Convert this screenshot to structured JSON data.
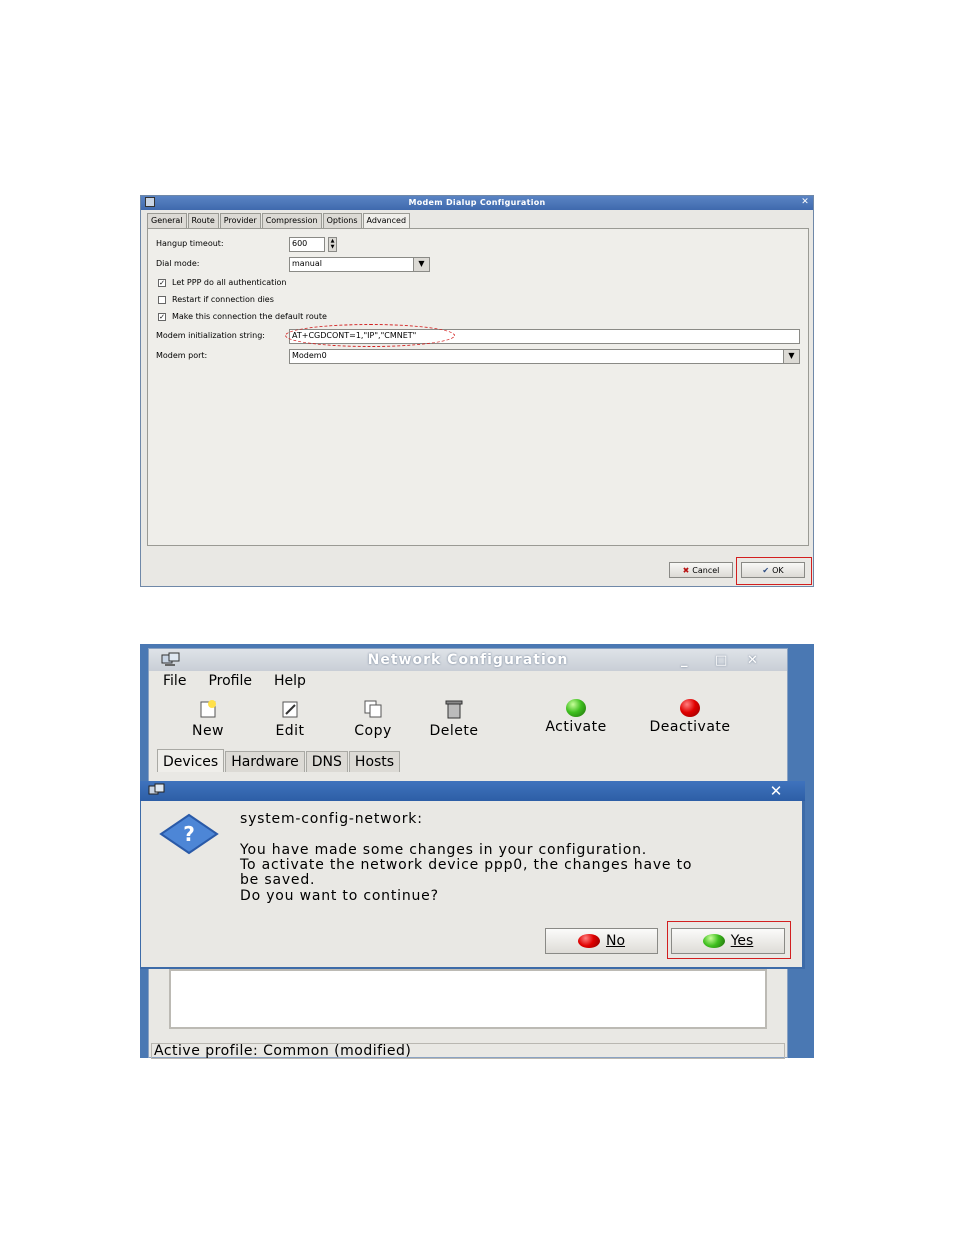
{
  "modem_dialog": {
    "title": "Modem Dialup Configuration",
    "tabs": [
      "General",
      "Route",
      "Provider",
      "Compression",
      "Options",
      "Advanced"
    ],
    "active_tab": "Advanced",
    "hangup_timeout_label": "Hangup timeout:",
    "hangup_timeout_value": "600",
    "dial_mode_label": "Dial mode:",
    "dial_mode_value": "manual",
    "check_ppp_auth": {
      "label": "Let PPP do all authentication",
      "checked": true
    },
    "check_restart": {
      "label": "Restart if connection dies",
      "checked": false
    },
    "check_default_route": {
      "label": "Make this connection the default route",
      "checked": true
    },
    "init_string_label": "Modem initialization string:",
    "init_string_value": "AT+CGDCONT=1,\"IP\",\"CMNET\"",
    "modem_port_label": "Modem port:",
    "modem_port_value": "Modem0",
    "cancel_label": "Cancel",
    "ok_label": "OK"
  },
  "network_window": {
    "title": "Network Configuration",
    "menu": [
      "File",
      "Profile",
      "Help"
    ],
    "toolbar": [
      "New",
      "Edit",
      "Copy",
      "Delete",
      "Activate",
      "Deactivate"
    ],
    "tabs": [
      "Devices",
      "Hardware",
      "DNS",
      "Hosts"
    ],
    "active_tab": "Devices",
    "status": "Active profile: Common (modified)"
  },
  "message_dialog": {
    "heading": "system-config-network:",
    "line1": "You have made some changes in your configuration.",
    "line2": "To activate the network device ppp0, the changes have to",
    "line3": "be saved.",
    "line4": "Do you want to continue?",
    "no_label": "No",
    "yes_label": "Yes"
  },
  "colors": {
    "highlight": "#d21f1f",
    "titlebar_blue": "#3f69ad"
  }
}
